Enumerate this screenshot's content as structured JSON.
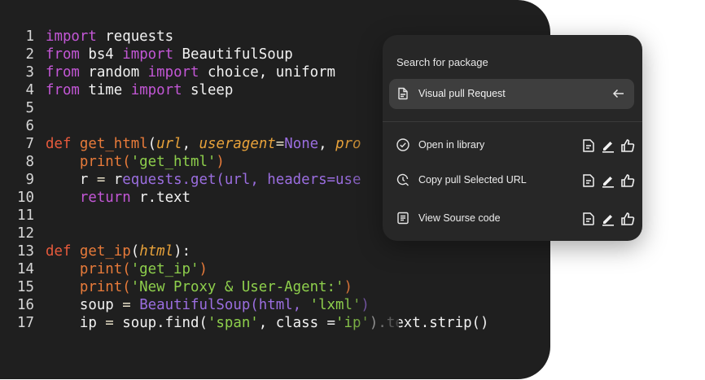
{
  "code": {
    "lines": [
      {
        "n": "1",
        "tokens": [
          {
            "t": "import",
            "c": "kw"
          },
          {
            "t": " requests",
            "c": "plain"
          }
        ]
      },
      {
        "n": "2",
        "tokens": [
          {
            "t": "from",
            "c": "kw"
          },
          {
            "t": " bs4 ",
            "c": "plain"
          },
          {
            "t": "import",
            "c": "kw"
          },
          {
            "t": " BeautifulSoup",
            "c": "plain"
          }
        ]
      },
      {
        "n": "3",
        "tokens": [
          {
            "t": "from",
            "c": "kw"
          },
          {
            "t": " random ",
            "c": "plain"
          },
          {
            "t": "import",
            "c": "kw"
          },
          {
            "t": " choice, uniform",
            "c": "plain"
          }
        ]
      },
      {
        "n": "4",
        "tokens": [
          {
            "t": "from",
            "c": "kw"
          },
          {
            "t": " time ",
            "c": "plain"
          },
          {
            "t": "import",
            "c": "kw"
          },
          {
            "t": " sleep",
            "c": "plain"
          }
        ]
      },
      {
        "n": "5",
        "tokens": []
      },
      {
        "n": "6",
        "tokens": []
      },
      {
        "n": "7",
        "tokens": [
          {
            "t": "def",
            "c": "def"
          },
          {
            "t": " ",
            "c": "plain"
          },
          {
            "t": "get_html",
            "c": "fn"
          },
          {
            "t": "(",
            "c": "plain"
          },
          {
            "t": "url",
            "c": "param"
          },
          {
            "t": ", ",
            "c": "plain"
          },
          {
            "t": "useragent",
            "c": "param"
          },
          {
            "t": "=",
            "c": "eq"
          },
          {
            "t": "None",
            "c": "none"
          },
          {
            "t": ", ",
            "c": "plain"
          },
          {
            "t": "pro",
            "c": "param"
          }
        ]
      },
      {
        "n": "8",
        "tokens": [
          {
            "t": "    print(",
            "c": "fn"
          },
          {
            "t": "'get_html'",
            "c": "str"
          },
          {
            "t": ")",
            "c": "fn"
          }
        ]
      },
      {
        "n": "9",
        "tokens": [
          {
            "t": "    r ",
            "c": "plain"
          },
          {
            "t": "=",
            "c": "eq"
          },
          {
            "t": " r",
            "c": "plain"
          },
          {
            "t": "equests.get(url, headers=use",
            "c": "cls"
          }
        ]
      },
      {
        "n": "10",
        "tokens": [
          {
            "t": "    return",
            "c": "kw"
          },
          {
            "t": " r.text",
            "c": "plain"
          }
        ]
      },
      {
        "n": "11",
        "tokens": []
      },
      {
        "n": "12",
        "tokens": []
      },
      {
        "n": "13",
        "tokens": [
          {
            "t": "def",
            "c": "def"
          },
          {
            "t": " ",
            "c": "plain"
          },
          {
            "t": "get_ip",
            "c": "fn"
          },
          {
            "t": "(",
            "c": "plain"
          },
          {
            "t": "html",
            "c": "param"
          },
          {
            "t": "):",
            "c": "plain"
          }
        ]
      },
      {
        "n": "14",
        "tokens": [
          {
            "t": "    print(",
            "c": "fn"
          },
          {
            "t": "'get_ip'",
            "c": "str"
          },
          {
            "t": ")",
            "c": "fn"
          }
        ]
      },
      {
        "n": "15",
        "tokens": [
          {
            "t": "    print(",
            "c": "fn"
          },
          {
            "t": "'New Proxy & User-Agent:'",
            "c": "str"
          },
          {
            "t": ")",
            "c": "fn"
          }
        ]
      },
      {
        "n": "16",
        "tokens": [
          {
            "t": "    soup ",
            "c": "plain"
          },
          {
            "t": "=",
            "c": "eq"
          },
          {
            "t": " BeautifulSoup(html, ",
            "c": "cls"
          },
          {
            "t": "'lxml'",
            "c": "str"
          },
          {
            "t": ")",
            "c": "cls"
          }
        ]
      },
      {
        "n": "17",
        "tokens": [
          {
            "t": "    ip ",
            "c": "plain"
          },
          {
            "t": "=",
            "c": "eq"
          },
          {
            "t": " soup.find(",
            "c": "plain"
          },
          {
            "t": "'span'",
            "c": "str"
          },
          {
            "t": ", class =",
            "c": "plain"
          },
          {
            "t": "'ip'",
            "c": "str"
          },
          {
            "t": ").text.strip()",
            "c": "plain"
          }
        ]
      }
    ]
  },
  "panel": {
    "title": "Search for package",
    "active": {
      "label": "Visual pull Request",
      "icon": "document-icon",
      "trailing_icon": "arrow-left-icon"
    },
    "items": [
      {
        "label": "Open in library",
        "icon": "check-circle-icon"
      },
      {
        "label": "Copy pull Selected URL",
        "icon": "search-refresh-icon"
      },
      {
        "label": "View Sourse code",
        "icon": "list-document-icon"
      }
    ],
    "action_icons": [
      "document-icon",
      "pencil-icon",
      "thumbs-up-icon"
    ]
  },
  "colors": {
    "editor_bg": "#1f1f1f",
    "panel_bg": "#272727",
    "active_row_bg": "#3e3e3e",
    "keyword": "#c357d6",
    "string": "#8ecf4c",
    "function": "#e87b3a"
  }
}
